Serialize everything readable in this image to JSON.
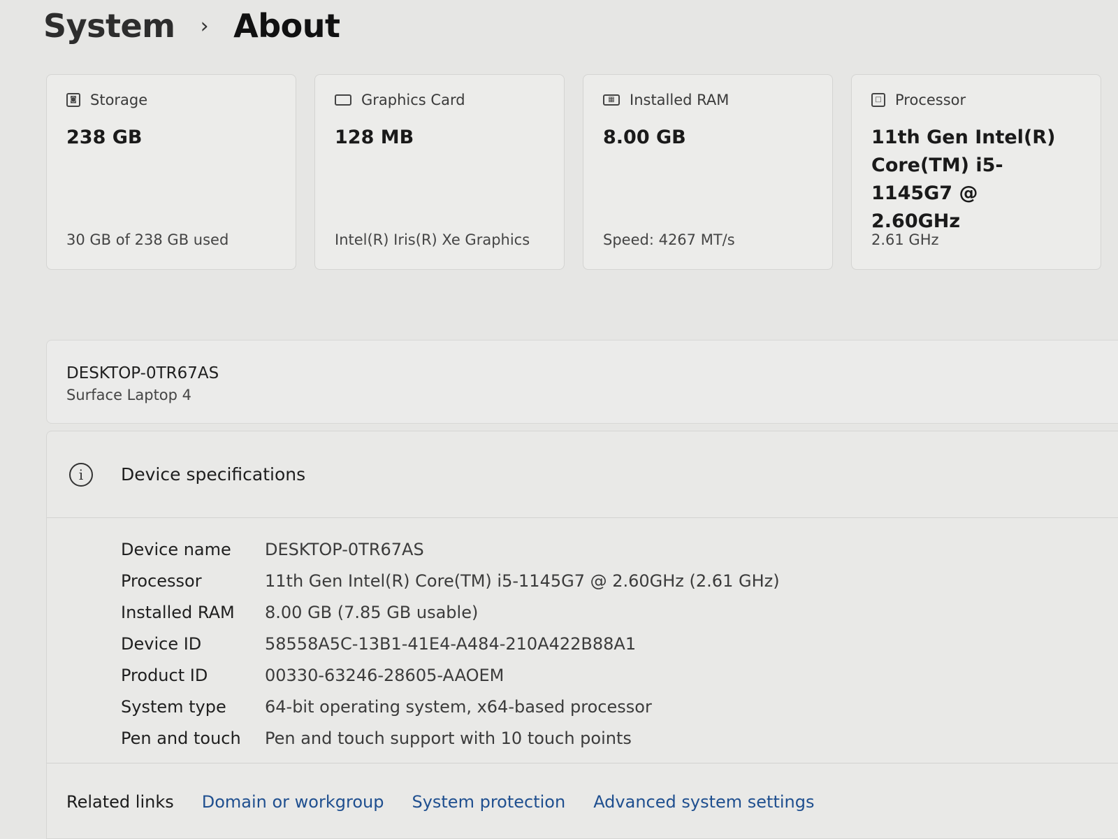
{
  "breadcrumb": {
    "parent": "System",
    "separator": "›",
    "current": "About"
  },
  "cards": [
    {
      "icon": "storage-icon",
      "title": "Storage",
      "value": "238 GB",
      "sub": "30 GB of 238 GB used"
    },
    {
      "icon": "graphics-card-icon",
      "title": "Graphics Card",
      "value": "128 MB",
      "sub": "Intel(R) Iris(R) Xe Graphics"
    },
    {
      "icon": "ram-icon",
      "title": "Installed RAM",
      "value": "8.00 GB",
      "sub": "Speed: 4267 MT/s"
    },
    {
      "icon": "processor-icon",
      "title": "Processor",
      "value_lines": [
        "11th Gen Intel(R)",
        "Core(TM) i5-1145G7 @",
        "2.60GHz"
      ],
      "sub": "2.61 GHz"
    }
  ],
  "device": {
    "name": "DESKTOP-0TR67AS",
    "model": "Surface Laptop 4"
  },
  "specs": {
    "title": "Device specifications",
    "rows": [
      {
        "label": "Device name",
        "value": "DESKTOP-0TR67AS"
      },
      {
        "label": "Processor",
        "value": "11th Gen Intel(R) Core(TM) i5-1145G7 @ 2.60GHz (2.61 GHz)"
      },
      {
        "label": "Installed RAM",
        "value": "8.00 GB (7.85 GB usable)"
      },
      {
        "label": "Device ID",
        "value": "58558A5C-13B1-41E4-A484-210A422B88A1"
      },
      {
        "label": "Product ID",
        "value": "00330-63246-28605-AAOEM"
      },
      {
        "label": "System type",
        "value": "64-bit operating system, x64-based processor"
      },
      {
        "label": "Pen and touch",
        "value": "Pen and touch support with 10 touch points"
      }
    ]
  },
  "related_links": {
    "label": "Related links",
    "links": [
      "Domain or workgroup",
      "System protection",
      "Advanced system settings"
    ]
  },
  "colors": {
    "link": "#1f4f8f",
    "background": "#e6e6e4",
    "card": "#ececea"
  }
}
